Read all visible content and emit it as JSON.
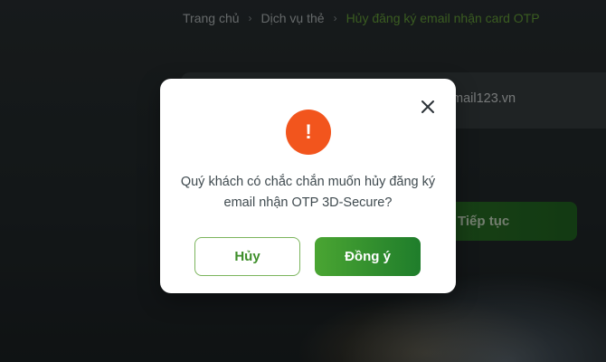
{
  "breadcrumb": {
    "items": [
      "Trang chủ",
      "Dịch vụ thẻ"
    ],
    "current": "Hủy đăng ký email nhận card OTP",
    "separator": "›"
  },
  "background_form": {
    "email_fragment": "mail123.vn",
    "continue_label": "Tiếp tục"
  },
  "modal": {
    "icon": "exclamation-icon",
    "icon_glyph": "!",
    "message_line1": "Quý khách có chắc chắn muốn hủy đăng ký",
    "message_line2": "email nhận OTP 3D-Secure?",
    "cancel_label": "Hủy",
    "confirm_label": "Đồng ý",
    "close_icon": "close-icon"
  },
  "colors": {
    "accent_green": "#3e8e2a",
    "warning_orange": "#f2551d",
    "breadcrumb_current": "#6aa83c"
  }
}
